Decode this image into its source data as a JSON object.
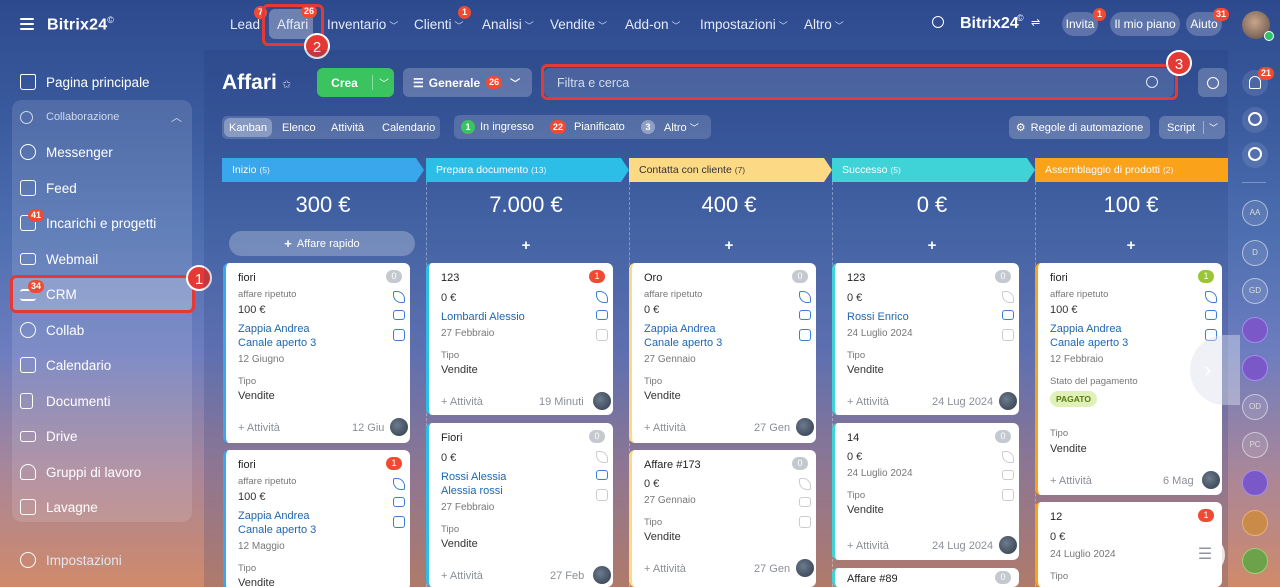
{
  "sidebar": {
    "logo": "Bitrix24",
    "logo_mark": "©",
    "items": [
      {
        "label": "Pagina principale",
        "icon": "home-icon"
      },
      {
        "label": "Collaborazione",
        "icon": "collab-icon"
      },
      {
        "label": "Messenger",
        "icon": "chat-icon"
      },
      {
        "label": "Feed",
        "icon": "feed-icon"
      },
      {
        "label": "Incarichi e progetti",
        "icon": "tasks-icon",
        "badge": "41"
      },
      {
        "label": "Webmail",
        "icon": "mail-icon"
      },
      {
        "label": "CRM",
        "icon": "crm-icon",
        "badge": "34"
      },
      {
        "label": "Collab",
        "icon": "collab-circle-icon"
      },
      {
        "label": "Calendario",
        "icon": "calendar-icon"
      },
      {
        "label": "Documenti",
        "icon": "document-icon"
      },
      {
        "label": "Drive",
        "icon": "drive-icon"
      },
      {
        "label": "Gruppi di lavoro",
        "icon": "groups-icon"
      },
      {
        "label": "Lavagne",
        "icon": "board-icon"
      }
    ],
    "settings": "Impostazioni"
  },
  "topnav": {
    "items": [
      {
        "label": "Lead",
        "badge": "7"
      },
      {
        "label": "Affari",
        "badge": "26"
      },
      {
        "label": "Inventario"
      },
      {
        "label": "Clienti",
        "badge": "1"
      },
      {
        "label": "Analisi"
      },
      {
        "label": "Vendite"
      },
      {
        "label": "Add-on"
      },
      {
        "label": "Impostazioni"
      },
      {
        "label": "Altro"
      }
    ],
    "brand": "Bitrix24",
    "invite": "Invita",
    "invite_badge": "1",
    "plan": "Il mio piano",
    "help": "Aiuto",
    "help_badge": "31"
  },
  "header": {
    "title": "Affari",
    "create": "Crea",
    "filter": "Generale",
    "filter_badge": "26",
    "search_placeholder": "Filtra e cerca"
  },
  "views": [
    "Kanban",
    "Elenco",
    "Attività",
    "Calendario"
  ],
  "counters": {
    "incoming_count": "1",
    "incoming": "In ingresso",
    "planned_count": "22",
    "planned": "Pianificato",
    "other_count": "3",
    "other": "Altro"
  },
  "automation": "Regole di automazione",
  "script": "Script",
  "quick_deal": "Affare rapido",
  "columns": [
    {
      "name": "Inizio",
      "count": "(5)",
      "sum": "300 €",
      "color": "#3aa6ec"
    },
    {
      "name": "Prepara documento",
      "count": "(13)",
      "sum": "7.000 €",
      "color": "#2dbee8"
    },
    {
      "name": "Contatta con cliente",
      "count": "(7)",
      "sum": "400 €",
      "color": "#fbd985"
    },
    {
      "name": "Successo",
      "count": "(5)",
      "sum": "0 €",
      "color": "#3fd3d8"
    },
    {
      "name": "Assemblaggio di prodotti",
      "count": "(2)",
      "sum": "100 €",
      "color": "#f9a21a"
    }
  ],
  "cards": {
    "c1": {
      "title": "fiori",
      "sub": "affare ripetuto",
      "amount": "100 €",
      "l1": "Zappia Andrea",
      "l2": "Canale aperto 3",
      "date": "12 Giugno",
      "type_lbl": "Tipo",
      "type": "Vendite",
      "act": "+ Attività",
      "d": "12 Giu",
      "cnt": "0"
    },
    "c2": {
      "title": "fiori",
      "sub": "affare ripetuto",
      "amount": "100 €",
      "l1": "Zappia Andrea",
      "l2": "Canale aperto 3",
      "date": "12 Maggio",
      "type_lbl": "Tipo",
      "type": "Vendite",
      "cnt": "1"
    },
    "c3": {
      "title": "123",
      "amount": "0 €",
      "l1": "Lombardi Alessio",
      "date": "27 Febbraio",
      "type_lbl": "Tipo",
      "type": "Vendite",
      "act": "+ Attività",
      "d": "19 Minuti",
      "cnt": "1"
    },
    "c4": {
      "title": "Fiori",
      "amount": "0 €",
      "l1": "Rossi Alessia",
      "l2": "Alessia rossi",
      "date": "27 Febbraio",
      "type_lbl": "Tipo",
      "type": "Vendite",
      "act": "+ Attività",
      "d": "27 Feb",
      "cnt": "0"
    },
    "c5": {
      "title": "Oro",
      "sub": "affare ripetuto",
      "amount": "0 €",
      "l1": "Zappia Andrea",
      "l2": "Canale aperto 3",
      "date": "27 Gennaio",
      "type_lbl": "Tipo",
      "type": "Vendite",
      "act": "+ Attività",
      "d": "27 Gen",
      "cnt": "0"
    },
    "c6": {
      "title": "Affare #173",
      "amount": "0 €",
      "date": "27 Gennaio",
      "type_lbl": "Tipo",
      "type": "Vendite",
      "act": "+ Attività",
      "d": "27 Gen",
      "cnt": "0"
    },
    "c7": {
      "title": "123",
      "amount": "0 €",
      "l1": "Rossi Enrico",
      "date": "24 Luglio 2024",
      "type_lbl": "Tipo",
      "type": "Vendite",
      "act": "+ Attività",
      "d": "24 Lug 2024",
      "cnt": "0"
    },
    "c8": {
      "title": "14",
      "amount": "0 €",
      "date": "24 Luglio 2024",
      "type_lbl": "Tipo",
      "type": "Vendite",
      "act": "+ Attività",
      "d": "24 Lug 2024",
      "cnt": "0"
    },
    "c9": {
      "title": "Affare #89",
      "cnt": "0"
    },
    "c10": {
      "title": "fiori",
      "sub": "affare ripetuto",
      "amount": "100 €",
      "l1": "Zappia Andrea",
      "l2": "Canale aperto 3",
      "date": "12 Febbraio",
      "pay_lbl": "Stato del pagamento",
      "pay": "PAGATO",
      "type_lbl": "Tipo",
      "type": "Vendite",
      "act": "+ Attività",
      "d": "6 Mag",
      "cnt": "1"
    },
    "c11": {
      "title": "12",
      "amount": "0 €",
      "date": "24 Luglio 2024",
      "type_lbl": "Tipo",
      "cnt": "1"
    }
  },
  "rightbar": {
    "notif_badge": "21",
    "avatars": [
      "AA",
      "D",
      "GD",
      "OD",
      "PC"
    ]
  },
  "callouts": [
    "1",
    "2",
    "3"
  ]
}
